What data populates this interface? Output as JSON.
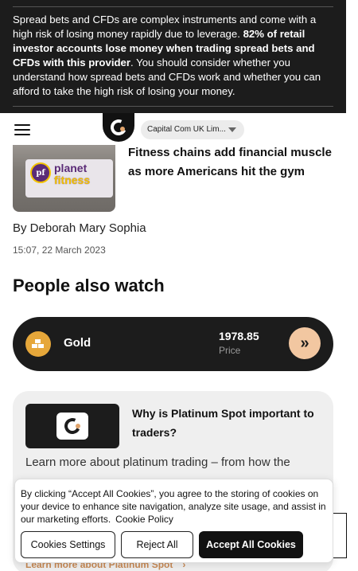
{
  "risk_warning": {
    "text_before": "Spread bets and CFDs are complex instruments and come with a high risk of losing money rapidly due to leverage. ",
    "text_bold": "82% of retail investor accounts lose money when trading spread bets and CFDs with this provider",
    "text_after": ". You should consider whether you understand how spread bets and CFDs work and whether you can afford to take the high risk of losing your money."
  },
  "header": {
    "entity_selector": "Capital Com UK Lim...",
    "icons": {
      "menu": "hamburger-menu-icon",
      "logo": "capital-com-logo",
      "dropdown": "caret-down-icon"
    }
  },
  "article": {
    "title": "Fitness chains add financial muscle as more Americans hit the gym",
    "author": "By Deborah Mary Sophia",
    "date": "15:07, 22 March 2023",
    "thumbnail": {
      "logo_mark": "pf",
      "logo_line1": "planet",
      "logo_line2": "fitness"
    }
  },
  "people_also_watch": {
    "heading": "People also watch",
    "items": [
      {
        "name": "Gold",
        "value": "1978.85",
        "caption": "Price",
        "icon": "gold-bars-icon",
        "action_icon": "double-chevron-right-icon"
      }
    ]
  },
  "info_card": {
    "title": "Why is Platinum Spot important to traders?",
    "description": "Learn more about platinum trading – from how the",
    "link": "Learn more about Platinum Spot",
    "link_icon": "chevron-right-icon"
  },
  "cookie_banner": {
    "text": "By clicking “Accept All Cookies”, you agree to the storing of cookies on your device to enhance site navigation, analyze site usage, and assist in our marketing efforts.",
    "policy_link": "Cookie Policy",
    "settings_button": "Cookies Settings",
    "reject_button": "Reject All",
    "accept_button": "Accept All Cookies"
  },
  "colors": {
    "dark": "#1c1c1c",
    "accent": "#f2c7a1",
    "gold": "#e6a73a",
    "link": "#c88a55",
    "card_bg": "#efefef"
  }
}
